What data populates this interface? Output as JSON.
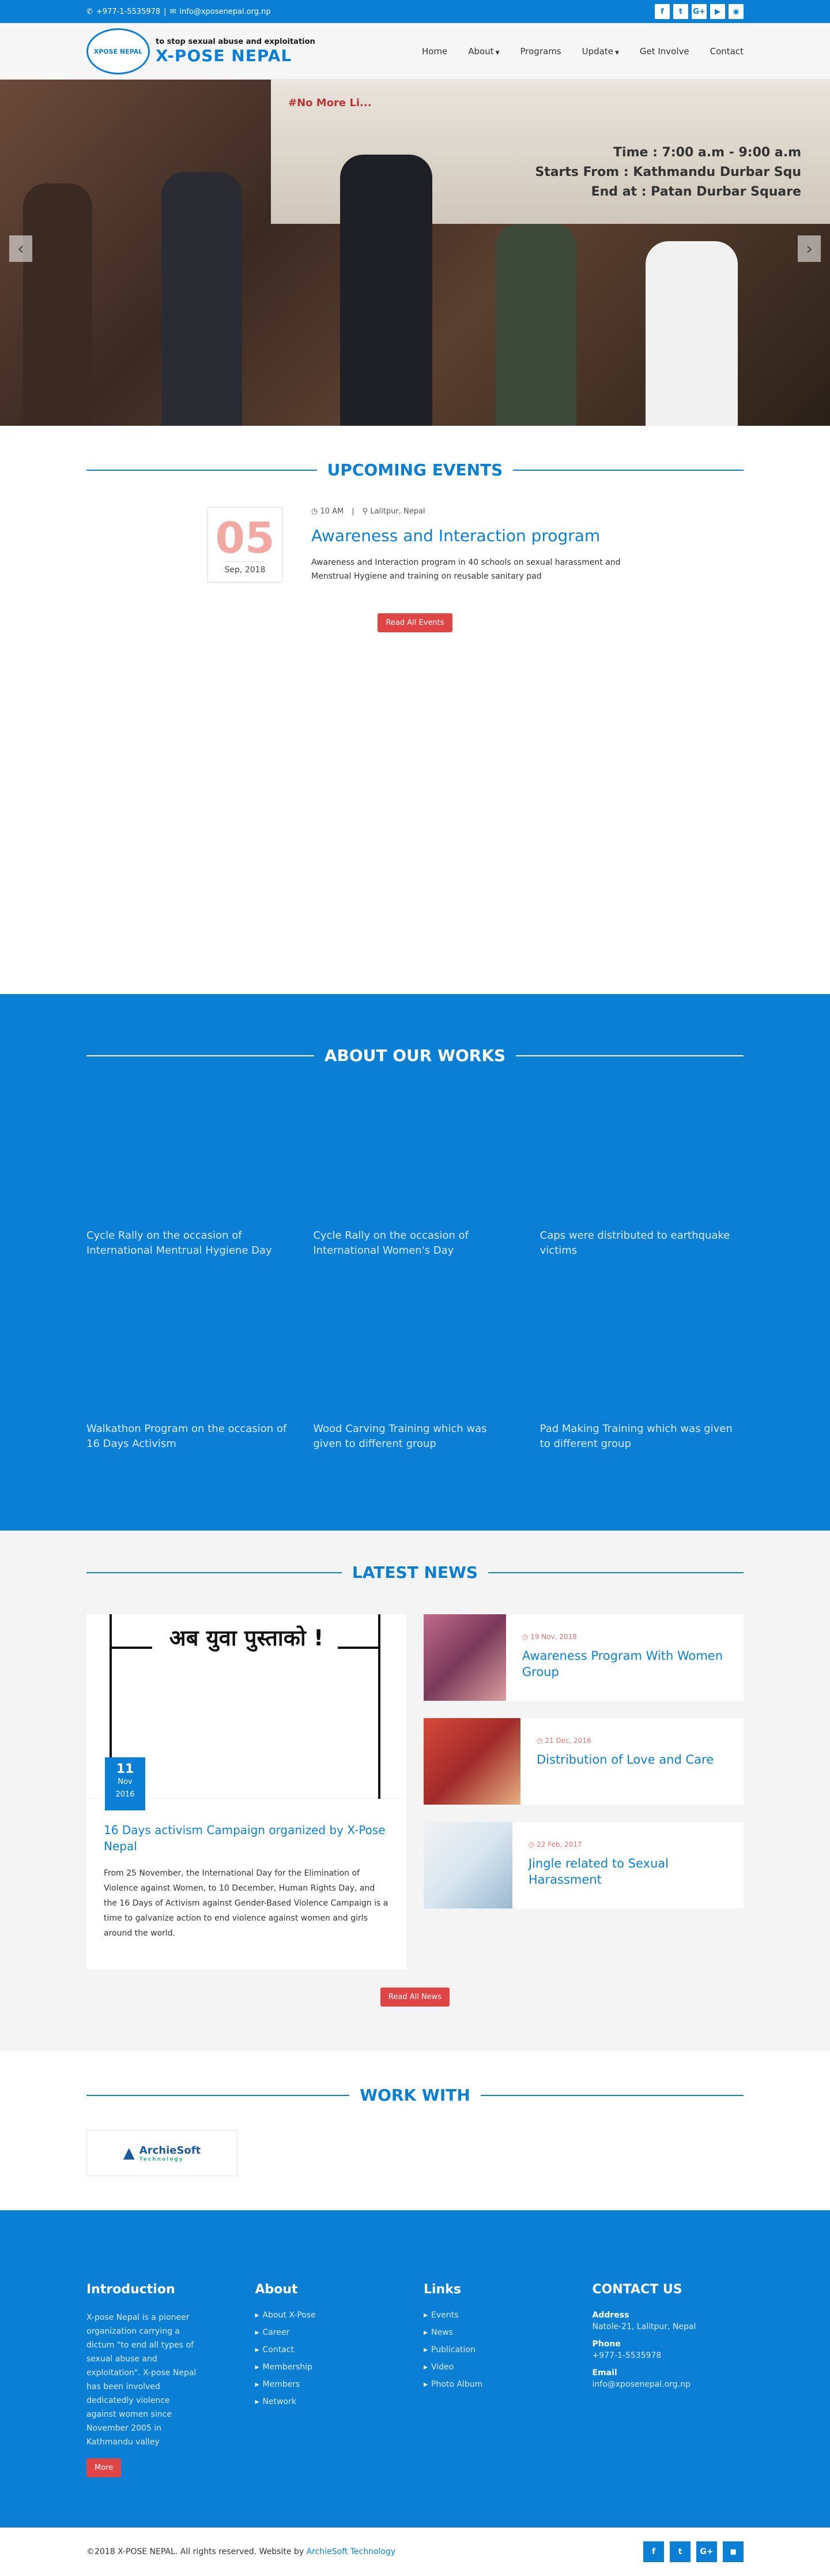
{
  "topbar": {
    "phone": "+977-1-5535978",
    "separator": "|",
    "email": "info@xposenepal.org.np",
    "social": [
      "f",
      "t",
      "G+",
      "▶",
      "◉"
    ]
  },
  "brand": {
    "logo_text": "XPOSE NEPAL",
    "tagline": "to stop sexual abuse and exploitation",
    "name": "X-POSE NEPAL"
  },
  "nav": {
    "items": [
      {
        "label": "Home"
      },
      {
        "label": "About",
        "dropdown": true
      },
      {
        "label": "Programs"
      },
      {
        "label": "Update",
        "dropdown": true
      },
      {
        "label": "Get Involve"
      },
      {
        "label": "Contact"
      }
    ]
  },
  "hero": {
    "banner_left": "#No More Li...",
    "banner_line1": "Time : 7:00 a.m - 9:00 a.m",
    "banner_line2": "Starts From : Kathmandu Durbar Squ",
    "banner_line3": "End at : Patan Durbar Square",
    "prev_arrow": "‹",
    "next_arrow": "›"
  },
  "events": {
    "heading": "UPCOMING EVENTS",
    "items": [
      {
        "day": "05",
        "month_year": "Sep, 2018",
        "time": "10 AM",
        "location": "Lalitpur, Nepal",
        "title": "Awareness and Interaction program",
        "description": "Awareness and Interaction program in 40 schools on sexual harassment and Menstrual Hygiene and training on reusable sanitary pad"
      }
    ],
    "button": "Read All Events"
  },
  "works": {
    "heading": "ABOUT OUR WORKS",
    "items": [
      "Cycle Rally on the occasion of International Mentrual Hygiene Day",
      "Cycle Rally on the occasion of International Women's Day",
      "Caps were distributed to earthquake victims",
      "Walkathon Program on the occasion of 16 Days Activism",
      "Wood Carving Training which was given to different group",
      "Pad Making Training which was given to different group"
    ]
  },
  "news": {
    "heading": "LATEST NEWS",
    "featured": {
      "image_text": "अब युवा पुस्ताको !",
      "day": "11",
      "month": "Nov",
      "year": "2016",
      "title": "16 Days activism Campaign organized by X-Pose Nepal",
      "text": "From 25 November, the International Day for the Elimination of Violence against Women, to 10 December, Human Rights Day, and the 16 Days of Activism against Gender-Based Violence Campaign is a time to galvanize action to end violence against women and girls around the world."
    },
    "items": [
      {
        "date": "19 Nov, 2018",
        "title": "Awareness Program With Women Group"
      },
      {
        "date": "21 Dec, 2016",
        "title": "Distribution of Love and Care"
      },
      {
        "date": "22 Feb, 2017",
        "title": "Jingle related to Sexual Harassment"
      }
    ],
    "button": "Read All News"
  },
  "workwith": {
    "heading": "WORK WITH",
    "partner_name": "ArchieSoft",
    "partner_sub": "Technology"
  },
  "footer": {
    "intro_heading": "Introduction",
    "intro_text": "X-pose Nepal is a pioneer organization carrying a dictum \"to end all types of sexual abuse and exploitation\". X-pose Nepal has been involved dedicatedly violence against women since November 2005 in Kathmandu valley",
    "more_button": "More",
    "about_heading": "About",
    "about_links": [
      "About X-Pose",
      "Career",
      "Contact",
      "Membership",
      "Members",
      "Network"
    ],
    "links_heading": "Links",
    "links": [
      "Events",
      "News",
      "Publication",
      "Video",
      "Photo Album"
    ],
    "contact_heading": "CONTACT US",
    "address_label": "Address",
    "address": "Natole-21, Lalitpur, Nepal",
    "phone_label": "Phone",
    "phone": "+977-1-5535978",
    "email_label": "Email",
    "email": "info@xposenepal.org.np"
  },
  "bottom": {
    "copyright": "©2018 X-POSE NEPAL. All rights reserved. Website by",
    "credit": "ArchieSoft Technology",
    "social": [
      "f",
      "t",
      "G+",
      "◼"
    ]
  }
}
